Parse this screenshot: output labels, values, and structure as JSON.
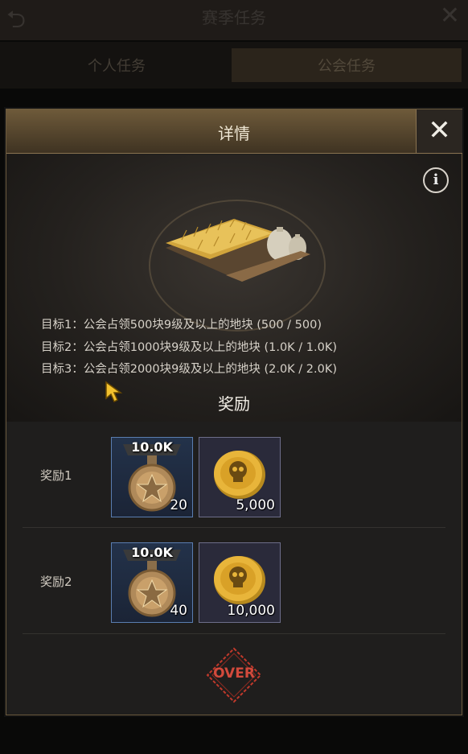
{
  "background": {
    "title": "赛季任务",
    "tabs": [
      {
        "label": "个人任务"
      },
      {
        "label": "公会任务"
      }
    ]
  },
  "dialog": {
    "title": "详情",
    "close_label": "✕",
    "info_label": "i",
    "goals": [
      {
        "text": "目标1：公会占领500块9级及以上的地块 (500 / 500)"
      },
      {
        "text": "目标2：公会占领1000块9级及以上的地块 (1.0K / 1.0K)"
      },
      {
        "text": "目标3：公会占领2000块9级及以上的地块 (2.0K / 2.0K)"
      }
    ],
    "rewards_heading": "奖励",
    "reward_rows": [
      {
        "label": "奖励1",
        "medal_badge": "10.0K",
        "medal_qty": "20",
        "coin_qty": "5,000"
      },
      {
        "label": "奖励2",
        "medal_badge": "10.0K",
        "medal_qty": "40",
        "coin_qty": "10,000"
      }
    ],
    "status_stamp": "OVER"
  },
  "colors": {
    "accent_gold": "#d9a640",
    "stamp_red": "#d24a3c",
    "header_brown": "#6e5a3a"
  }
}
